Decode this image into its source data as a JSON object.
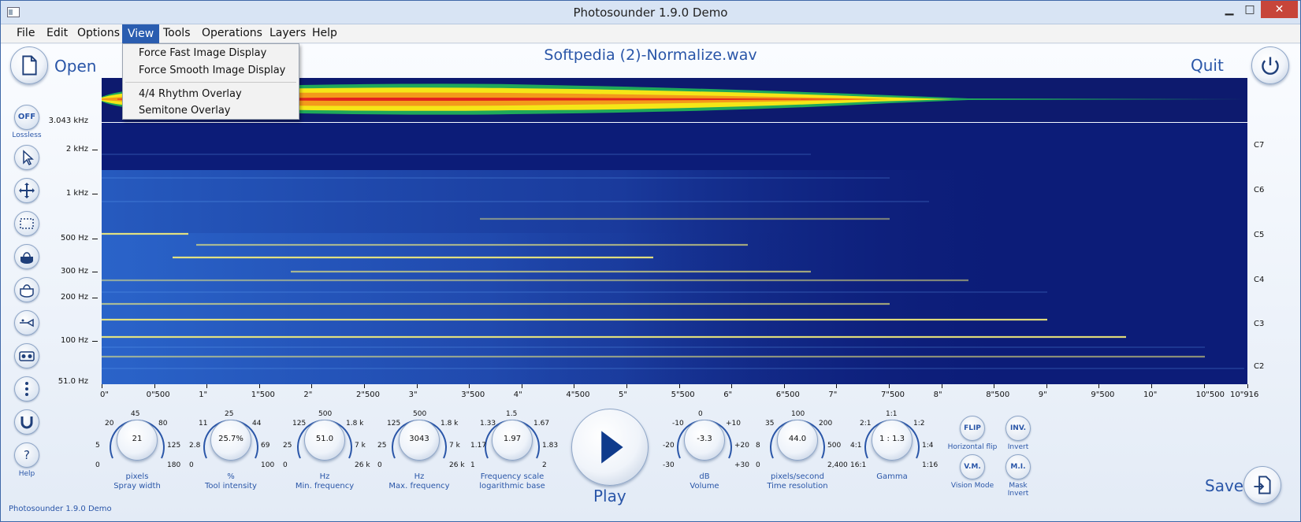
{
  "window": {
    "title": "Photosounder 1.9.0 Demo",
    "min": "▁",
    "max": "□",
    "close": "✕"
  },
  "menus": [
    "File",
    "Edit",
    "Options",
    "View",
    "Tools",
    "Operations",
    "Layers",
    "Help"
  ],
  "view_menu": {
    "items": [
      "Force Fast Image Display",
      "Force Smooth Image Display",
      "4/4 Rhythm Overlay",
      "Semitone Overlay"
    ]
  },
  "header": {
    "filename": "Softpedia (2)-Normalize.wav",
    "open_label": "Open",
    "quit_label": "Quit",
    "save_label": "Save"
  },
  "left_toolbar": {
    "lossless_btn": "OFF",
    "lossless_label": "Lossless",
    "help_label": "Help",
    "tools": [
      "select-icon",
      "move-icon",
      "marquee-icon",
      "bucket-fill-icon",
      "bucket-empty-icon",
      "trumpet-icon",
      "tape-icon",
      "vertical-dots-icon",
      "magnet-icon",
      "help-icon"
    ]
  },
  "freq_axis": {
    "top": "3.043 kHz",
    "labels": [
      "2 kHz",
      "1 kHz",
      "500 Hz",
      "300 Hz",
      "200 Hz",
      "100 Hz",
      "51.0 Hz"
    ]
  },
  "note_axis": {
    "labels": [
      "C7",
      "C6",
      "C5",
      "C4",
      "C3",
      "C2"
    ]
  },
  "time_axis": {
    "labels": [
      "0\"",
      "0\"500",
      "1\"",
      "1\"500",
      "2\"",
      "2\"500",
      "3\"",
      "3\"500",
      "4\"",
      "4\"500",
      "5\"",
      "5\"500",
      "6\"",
      "6\"500",
      "7\"",
      "7\"500",
      "8\"",
      "8\"500",
      "9\"",
      "9\"500",
      "10\"",
      "10\"500",
      "10\"916"
    ]
  },
  "knobs": [
    {
      "value": "21",
      "unit": "pixels",
      "name": "Spray width",
      "scale": [
        "0",
        "5",
        "20",
        "45",
        "80",
        "125",
        "180"
      ]
    },
    {
      "value": "25.7%",
      "unit": "%",
      "name": "Tool intensity",
      "scale": [
        "0",
        "2.8",
        "11",
        "25",
        "44",
        "69",
        "100"
      ]
    },
    {
      "value": "51.0",
      "unit": "Hz",
      "name": "Min. frequency",
      "scale": [
        "0",
        "25",
        "125",
        "500",
        "1.8 k",
        "7 k",
        "26 k"
      ]
    },
    {
      "value": "3043",
      "unit": "Hz",
      "name": "Max. frequency",
      "scale": [
        "0",
        "25",
        "125",
        "500",
        "1.8 k",
        "7 k",
        "26 k"
      ]
    },
    {
      "value": "1.97",
      "unit": "Frequency scale",
      "name": "logarithmic base",
      "scale": [
        "1",
        "1.17",
        "1.33",
        "1.5",
        "1.67",
        "1.83",
        "2"
      ]
    },
    {
      "value": "-3.3",
      "unit": "dB",
      "name": "Volume",
      "scale": [
        "-30",
        "-20",
        "-10",
        "0",
        "+10",
        "+20",
        "+30"
      ]
    },
    {
      "value": "44.0",
      "unit": "pixels/second",
      "name": "Time resolution",
      "scale": [
        "0",
        "8",
        "35",
        "100",
        "200",
        "500",
        "2,400"
      ]
    },
    {
      "value": "1 : 1.3",
      "unit": "Gamma",
      "name": "",
      "scale": [
        "16:1",
        "4:1",
        "2:1",
        "1:1",
        "1:2",
        "1:4",
        "1:16"
      ]
    }
  ],
  "play_label": "Play",
  "mode_buttons": [
    {
      "btn": "FLIP",
      "label": "Horizontal flip"
    },
    {
      "btn": "INV.",
      "label": "Invert"
    },
    {
      "btn": "V.M.",
      "label": "Vision Mode"
    },
    {
      "btn": "M.I.",
      "label": "Mask Invert"
    }
  ],
  "status": "Photosounder 1.9.0 Demo",
  "colors": {
    "accent": "#2a56a8",
    "spectro_bg": "#0b1a72",
    "menu_highlight": "#2a5db0",
    "close_red": "#c7453a"
  }
}
